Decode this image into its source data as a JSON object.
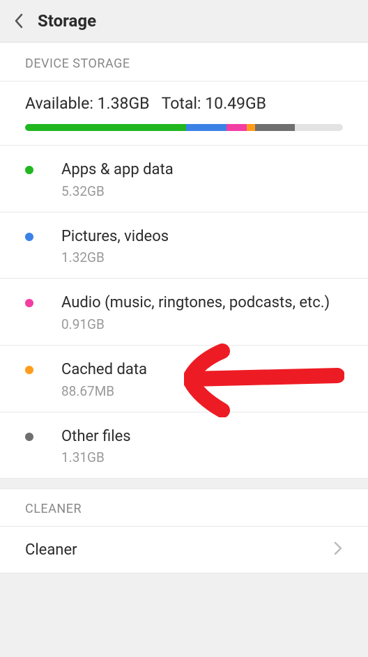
{
  "header": {
    "title": "Storage"
  },
  "device_storage": {
    "section_label": "DEVICE STORAGE",
    "available_label": "Available: ",
    "available_value": "1.38GB",
    "total_label": "Total: ",
    "total_value": "10.49GB",
    "bar_segments": [
      {
        "color": "#20b720",
        "percent": 50.7
      },
      {
        "color": "#3b82e6",
        "percent": 12.6
      },
      {
        "color": "#f23ea2",
        "percent": 6.5
      },
      {
        "color": "#ff9c1b",
        "percent": 2.5
      },
      {
        "color": "#6f6f6f",
        "percent": 12.5
      }
    ],
    "items": [
      {
        "dot_color": "#20b720",
        "title": "Apps & app data",
        "sub": "5.32GB"
      },
      {
        "dot_color": "#3b82e6",
        "title": "Pictures, videos",
        "sub": "1.32GB"
      },
      {
        "dot_color": "#f23ea2",
        "title": "Audio (music, ringtones, podcasts, etc.)",
        "sub": "0.91GB"
      },
      {
        "dot_color": "#ff9c1b",
        "title": "Cached data",
        "sub": "88.67MB"
      },
      {
        "dot_color": "#6f6f6f",
        "title": "Other files",
        "sub": "1.31GB"
      }
    ]
  },
  "cleaner": {
    "section_label": "CLEANER",
    "row_label": "Cleaner"
  },
  "annotation": {
    "type": "arrow",
    "color": "#ed1c24",
    "points_to": "device_storage.items.3"
  }
}
